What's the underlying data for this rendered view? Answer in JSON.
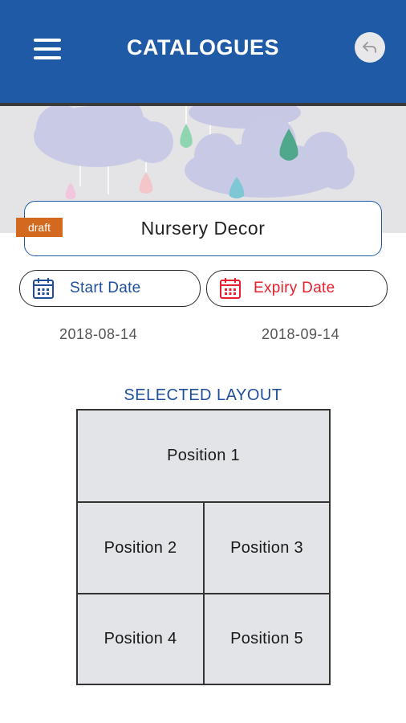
{
  "header": {
    "title": "CATALOGUES",
    "menu_icon": "hamburger-menu-icon",
    "back_icon": "back-arrow-icon",
    "background_color": "#1f5aa6"
  },
  "catalogue": {
    "name": "Nursery Decor",
    "status_badge": "draft",
    "badge_color": "#d2691e"
  },
  "dates": {
    "start_label": "Start Date",
    "start_value": "2018-08-14",
    "start_color": "#1f4f9c",
    "expiry_label": "Expiry Date",
    "expiry_value": "2018-09-14",
    "expiry_color": "#e8202e",
    "icon": "calendar-icon"
  },
  "layout": {
    "heading": "SELECTED LAYOUT",
    "positions": [
      "Position 1",
      "Position 2",
      "Position 3",
      "Position 4",
      "Position 5"
    ]
  }
}
